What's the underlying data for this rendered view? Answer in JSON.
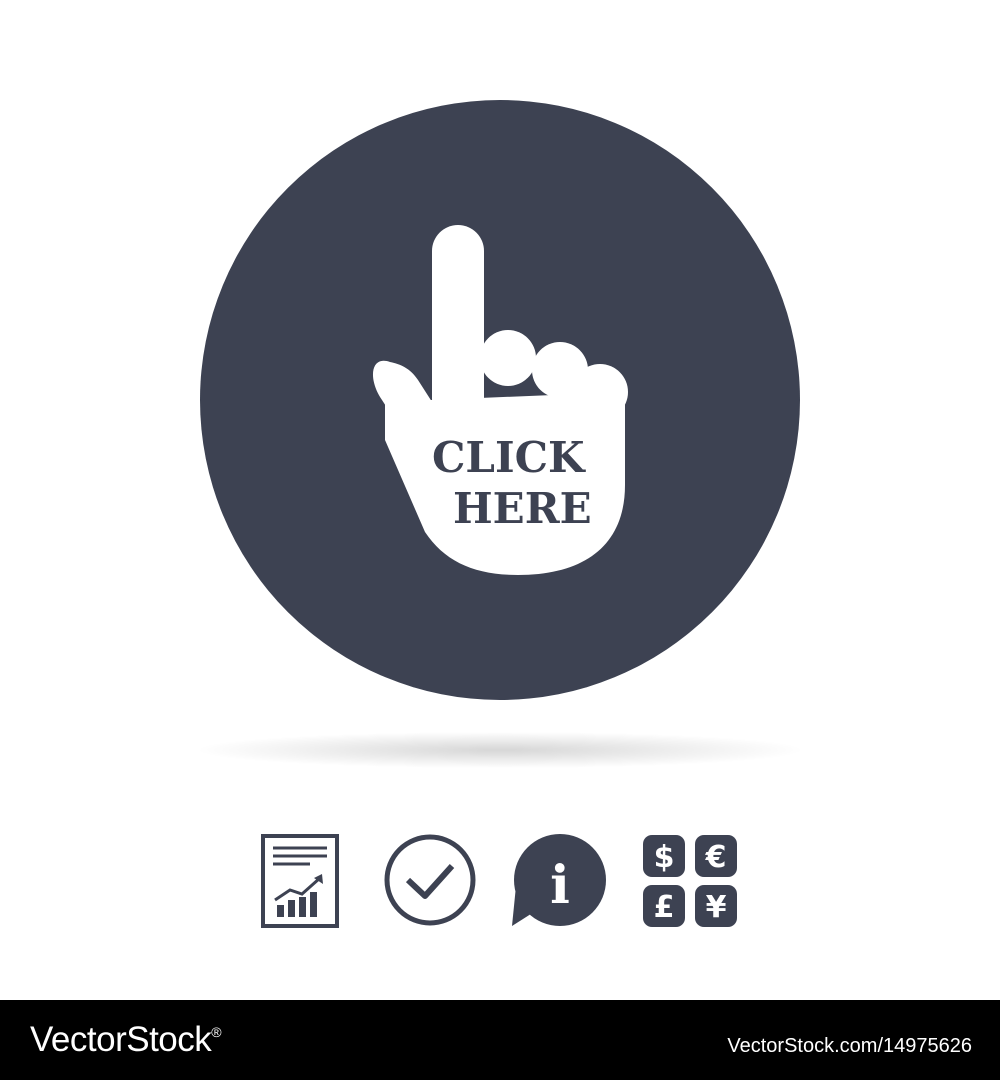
{
  "colors": {
    "icon": "#3d4252",
    "background": "#ffffff",
    "footer_background": "#000000",
    "footer_text": "#ffffff"
  },
  "main_icon": {
    "name": "hand-pointer-icon",
    "text_line_1": "CLICK",
    "text_line_2": "HERE"
  },
  "small_icons": [
    {
      "name": "report-chart-icon"
    },
    {
      "name": "check-circle-icon"
    },
    {
      "name": "info-speech-bubble-icon",
      "glyph": "i"
    },
    {
      "name": "currency-exchange-icon",
      "glyphs": [
        "$",
        "€",
        "£",
        "¥"
      ]
    }
  ],
  "footer": {
    "logo": "VectorStock",
    "logo_mark": "®",
    "id_text": "VectorStock.com/14975626"
  }
}
